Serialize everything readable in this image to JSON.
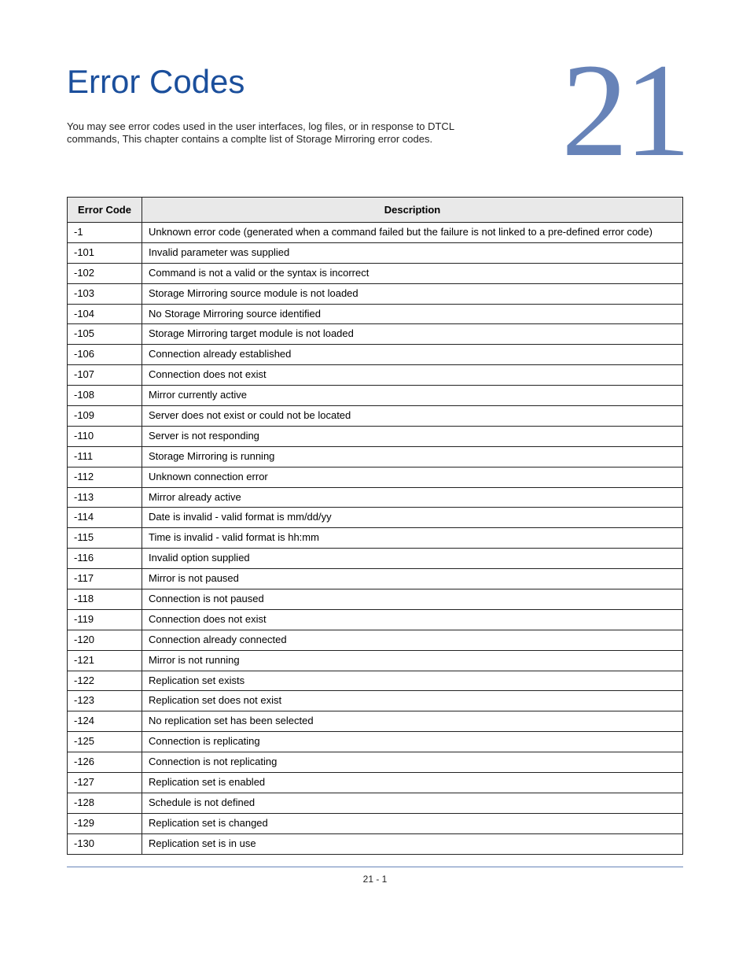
{
  "chapter_number": "21",
  "title": "Error Codes",
  "intro": "You may see error codes used in the user interfaces, log files, or in response to DTCL commands, This chapter contains a complte list of Storage Mirroring error codes.",
  "table": {
    "headers": {
      "code": "Error Code",
      "desc": "Description"
    },
    "rows": [
      {
        "code": "-1",
        "desc": "Unknown error code (generated when a command failed but the failure is not linked to a pre-defined error code)"
      },
      {
        "code": "-101",
        "desc": "Invalid parameter was supplied"
      },
      {
        "code": "-102",
        "desc": "Command is not a valid or the syntax is incorrect"
      },
      {
        "code": "-103",
        "desc": "Storage Mirroring source module is not loaded"
      },
      {
        "code": "-104",
        "desc": "No Storage Mirroring source identified"
      },
      {
        "code": "-105",
        "desc": "Storage Mirroring target module is not loaded"
      },
      {
        "code": "-106",
        "desc": "Connection already established"
      },
      {
        "code": "-107",
        "desc": "Connection does not exist"
      },
      {
        "code": "-108",
        "desc": "Mirror currently active"
      },
      {
        "code": "-109",
        "desc": "Server does not exist or could not be located"
      },
      {
        "code": "-110",
        "desc": "Server is not responding"
      },
      {
        "code": "-111",
        "desc": "Storage Mirroring is running"
      },
      {
        "code": "-112",
        "desc": "Unknown connection error"
      },
      {
        "code": "-113",
        "desc": "Mirror already active"
      },
      {
        "code": "-114",
        "desc": "Date is invalid - valid format is mm/dd/yy"
      },
      {
        "code": "-115",
        "desc": "Time is invalid - valid format is hh:mm"
      },
      {
        "code": "-116",
        "desc": "Invalid option supplied"
      },
      {
        "code": "-117",
        "desc": "Mirror is not paused"
      },
      {
        "code": "-118",
        "desc": "Connection is not paused"
      },
      {
        "code": "-119",
        "desc": "Connection does not exist"
      },
      {
        "code": "-120",
        "desc": "Connection already connected"
      },
      {
        "code": "-121",
        "desc": "Mirror is not running"
      },
      {
        "code": "-122",
        "desc": "Replication set exists"
      },
      {
        "code": "-123",
        "desc": "Replication set does not exist"
      },
      {
        "code": "-124",
        "desc": "No replication set has been selected"
      },
      {
        "code": "-125",
        "desc": "Connection is replicating"
      },
      {
        "code": "-126",
        "desc": "Connection is not replicating"
      },
      {
        "code": "-127",
        "desc": "Replication set is enabled"
      },
      {
        "code": "-128",
        "desc": "Schedule is not defined"
      },
      {
        "code": "-129",
        "desc": "Replication set is changed"
      },
      {
        "code": "-130",
        "desc": "Replication set is in use"
      }
    ]
  },
  "footer": "21 - 1"
}
